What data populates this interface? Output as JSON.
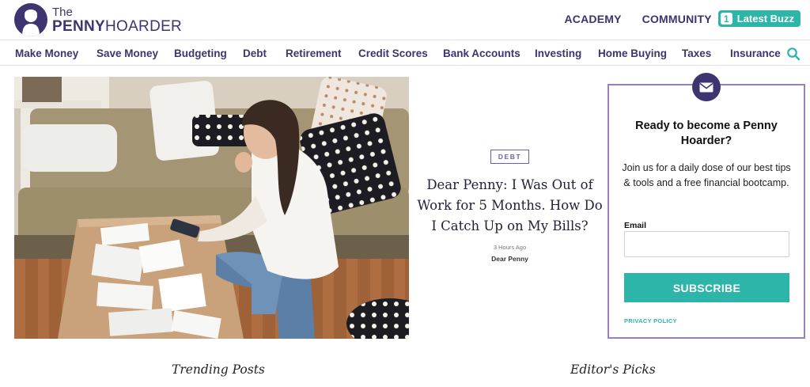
{
  "header": {
    "logo_the": "The",
    "logo_penny": "PENNY",
    "logo_hoarder": "HOARDER",
    "academy": "ACADEMY",
    "community": "COMMUNITY",
    "buzz_count": "1",
    "buzz_label": "Latest Buzz"
  },
  "nav": {
    "items": [
      {
        "label": "Make Money"
      },
      {
        "label": "Save Money"
      },
      {
        "label": "Budgeting"
      },
      {
        "label": "Debt"
      },
      {
        "label": "Retirement"
      },
      {
        "label": "Credit Scores"
      },
      {
        "label": "Bank Accounts"
      },
      {
        "label": "Investing"
      },
      {
        "label": "Home Buying"
      },
      {
        "label": "Taxes"
      },
      {
        "label": "Insurance"
      }
    ],
    "search_icon": "search-icon"
  },
  "article": {
    "tag": "DEBT",
    "headline": "Dear Penny: I Was Out of Work for 5 Months. How Do I Catch Up on My Bills?",
    "time": "3 Hours Ago",
    "author": "Dear Penny"
  },
  "subscribe": {
    "icon": "envelope-icon",
    "title": "Ready to become a Penny Hoarder?",
    "description": "Join us for a daily dose of our best tips & tools and a free financial bootcamp.",
    "email_label": "Email",
    "email_value": "",
    "button": "SUBSCRIBE",
    "privacy": "PRIVACY POLICY"
  },
  "sections": {
    "trending": "Trending Posts",
    "editors": "Editor's Picks"
  },
  "colors": {
    "brand_purple": "#3d3470",
    "teal": "#2cb5a8",
    "box_border": "#9b7fc0"
  }
}
